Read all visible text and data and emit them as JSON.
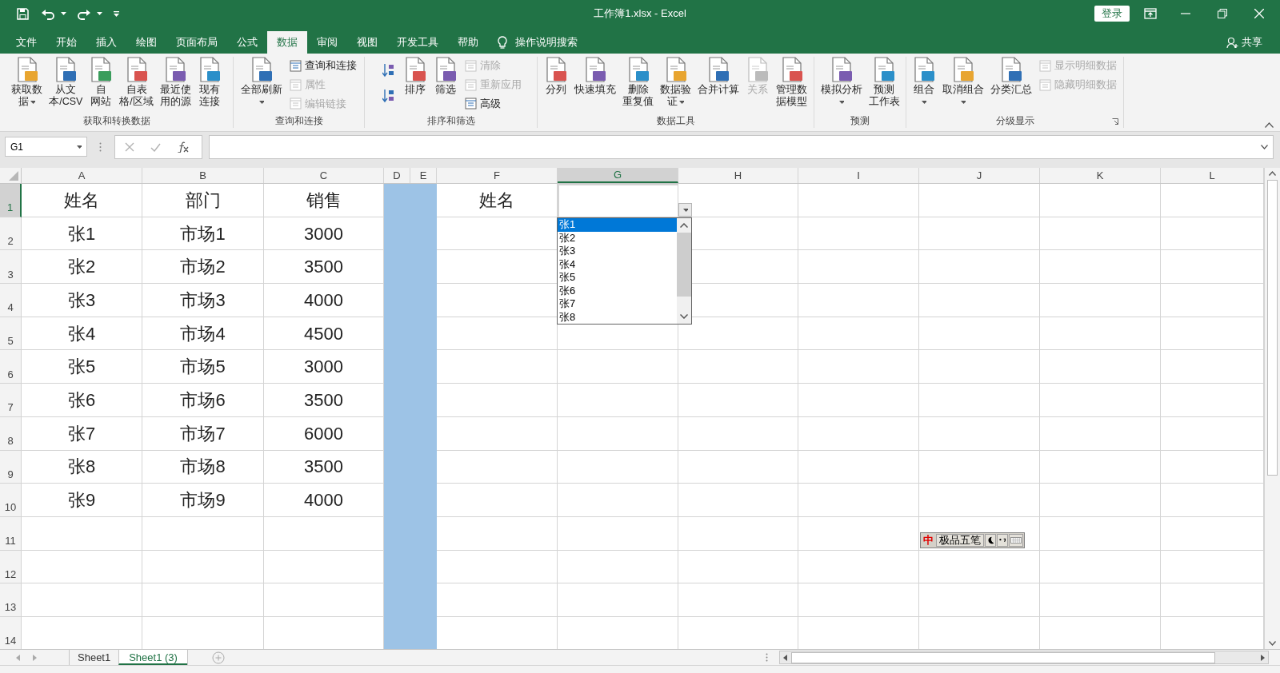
{
  "title_bar": {
    "title": "工作簿1.xlsx  -  Excel",
    "sign_in": "登录"
  },
  "tabs": [
    {
      "label": "文件",
      "selected": false
    },
    {
      "label": "开始",
      "selected": false
    },
    {
      "label": "插入",
      "selected": false
    },
    {
      "label": "绘图",
      "selected": false
    },
    {
      "label": "页面布局",
      "selected": false
    },
    {
      "label": "公式",
      "selected": false
    },
    {
      "label": "数据",
      "selected": true
    },
    {
      "label": "审阅",
      "selected": false
    },
    {
      "label": "视图",
      "selected": false
    },
    {
      "label": "开发工具",
      "selected": false
    },
    {
      "label": "帮助",
      "selected": false
    }
  ],
  "tell_me": "操作说明搜索",
  "share": "共享",
  "ribbon": {
    "groups": [
      {
        "label": "获取和转换数据",
        "launcher": false,
        "items": [
          {
            "kind": "large",
            "lines": [
              "获取数",
              "据"
            ],
            "dropdown": true,
            "disabled": false
          },
          {
            "kind": "large",
            "lines": [
              "从文",
              "本/CSV"
            ],
            "dropdown": false,
            "disabled": false
          },
          {
            "kind": "large",
            "lines": [
              "自",
              "网站"
            ],
            "dropdown": false,
            "disabled": false
          },
          {
            "kind": "large",
            "lines": [
              "自表",
              "格/区域"
            ],
            "dropdown": false,
            "disabled": false
          },
          {
            "kind": "large",
            "lines": [
              "最近使",
              "用的源"
            ],
            "dropdown": false,
            "disabled": false
          },
          {
            "kind": "large",
            "lines": [
              "现有",
              "连接"
            ],
            "dropdown": false,
            "disabled": false
          }
        ]
      },
      {
        "label": "查询和连接",
        "launcher": false,
        "items": [
          {
            "kind": "large",
            "lines": [
              "全部刷新"
            ],
            "dropdown": true,
            "disabled": false
          },
          {
            "kind": "stack",
            "items": [
              {
                "label": "查询和连接",
                "disabled": false
              },
              {
                "label": "属性",
                "disabled": true
              },
              {
                "label": "编辑链接",
                "disabled": true
              }
            ]
          }
        ]
      },
      {
        "label": "排序和筛选",
        "launcher": false,
        "items": [
          {
            "kind": "sort_pair"
          },
          {
            "kind": "large",
            "lines": [
              "排序"
            ],
            "dropdown": false,
            "disabled": false
          },
          {
            "kind": "large",
            "lines": [
              "筛选"
            ],
            "dropdown": false,
            "disabled": false
          },
          {
            "kind": "stack",
            "items": [
              {
                "label": "清除",
                "disabled": true
              },
              {
                "label": "重新应用",
                "disabled": true
              },
              {
                "label": "高级",
                "disabled": false
              }
            ]
          }
        ]
      },
      {
        "label": "数据工具",
        "launcher": false,
        "items": [
          {
            "kind": "large",
            "lines": [
              "分列"
            ],
            "dropdown": false,
            "disabled": false
          },
          {
            "kind": "large",
            "lines": [
              "快速填充"
            ],
            "dropdown": false,
            "disabled": false
          },
          {
            "kind": "large",
            "lines": [
              "删除",
              "重复值"
            ],
            "dropdown": false,
            "disabled": false
          },
          {
            "kind": "large",
            "lines": [
              "数据验",
              "证"
            ],
            "dropdown": true,
            "disabled": false
          },
          {
            "kind": "large",
            "lines": [
              "合并计算"
            ],
            "dropdown": false,
            "disabled": false
          },
          {
            "kind": "large",
            "lines": [
              "关系"
            ],
            "dropdown": false,
            "disabled": true
          },
          {
            "kind": "large",
            "lines": [
              "管理数",
              "据模型"
            ],
            "dropdown": false,
            "disabled": false
          }
        ]
      },
      {
        "label": "预测",
        "launcher": false,
        "items": [
          {
            "kind": "large",
            "lines": [
              "模拟分析"
            ],
            "dropdown": true,
            "disabled": false
          },
          {
            "kind": "large",
            "lines": [
              "预测",
              "工作表"
            ],
            "dropdown": false,
            "disabled": false
          }
        ]
      },
      {
        "label": "分级显示",
        "launcher": true,
        "items": [
          {
            "kind": "large",
            "lines": [
              "组合"
            ],
            "dropdown": true,
            "disabled": false
          },
          {
            "kind": "large",
            "lines": [
              "取消组合"
            ],
            "dropdown": true,
            "disabled": false
          },
          {
            "kind": "large",
            "lines": [
              "分类汇总"
            ],
            "dropdown": false,
            "disabled": false
          },
          {
            "kind": "stack",
            "items": [
              {
                "label": "显示明细数据",
                "disabled": true
              },
              {
                "label": "隐藏明细数据",
                "disabled": true
              }
            ]
          }
        ]
      }
    ]
  },
  "formula_bar": {
    "name_box": "G1"
  },
  "columns": [
    {
      "label": "A",
      "selected": false,
      "highlighted": false
    },
    {
      "label": "B",
      "selected": false,
      "highlighted": false
    },
    {
      "label": "C",
      "selected": false,
      "highlighted": false
    },
    {
      "label": "D",
      "selected": false,
      "highlighted": true
    },
    {
      "label": "E",
      "selected": false,
      "highlighted": true
    },
    {
      "label": "F",
      "selected": false,
      "highlighted": false
    },
    {
      "label": "G",
      "selected": true,
      "highlighted": false
    },
    {
      "label": "H",
      "selected": false,
      "highlighted": false
    },
    {
      "label": "I",
      "selected": false,
      "highlighted": false
    },
    {
      "label": "J",
      "selected": false,
      "highlighted": false
    },
    {
      "label": "K",
      "selected": false,
      "highlighted": false
    },
    {
      "label": "L",
      "selected": false,
      "highlighted": false
    }
  ],
  "rows": [
    {
      "header": "1",
      "selected": true,
      "cells": {
        "a": "姓名",
        "b": "部门",
        "c": "销售",
        "f": "姓名"
      }
    },
    {
      "header": "2",
      "selected": false,
      "cells": {
        "a": "张1",
        "b": "市场1",
        "c": "3000"
      }
    },
    {
      "header": "3",
      "selected": false,
      "cells": {
        "a": "张2",
        "b": "市场2",
        "c": "3500"
      }
    },
    {
      "header": "4",
      "selected": false,
      "cells": {
        "a": "张3",
        "b": "市场3",
        "c": "4000"
      }
    },
    {
      "header": "5",
      "selected": false,
      "cells": {
        "a": "张4",
        "b": "市场4",
        "c": "4500"
      }
    },
    {
      "header": "6",
      "selected": false,
      "cells": {
        "a": "张5",
        "b": "市场5",
        "c": "3000"
      }
    },
    {
      "header": "7",
      "selected": false,
      "cells": {
        "a": "张6",
        "b": "市场6",
        "c": "3500"
      }
    },
    {
      "header": "8",
      "selected": false,
      "cells": {
        "a": "张7",
        "b": "市场7",
        "c": "6000"
      }
    },
    {
      "header": "9",
      "selected": false,
      "cells": {
        "a": "张8",
        "b": "市场8",
        "c": "3500"
      }
    },
    {
      "header": "10",
      "selected": false,
      "cells": {
        "a": "张9",
        "b": "市场9",
        "c": "4000"
      }
    },
    {
      "header": "11",
      "selected": false
    },
    {
      "header": "12",
      "selected": false
    },
    {
      "header": "13",
      "selected": false
    },
    {
      "header": "14",
      "selected": false
    }
  ],
  "validation_list": {
    "items": [
      {
        "label": "张1",
        "selected": true
      },
      {
        "label": "张2",
        "selected": false
      },
      {
        "label": "张3",
        "selected": false
      },
      {
        "label": "张4",
        "selected": false
      },
      {
        "label": "张5",
        "selected": false
      },
      {
        "label": "张6",
        "selected": false
      },
      {
        "label": "张7",
        "selected": false
      },
      {
        "label": "张8",
        "selected": false
      }
    ]
  },
  "ime_toolbar": {
    "mode": "中",
    "label": "极品五笔"
  },
  "sheet_tabs": [
    {
      "label": "Sheet1",
      "selected": false
    },
    {
      "label": "Sheet1 (3)",
      "selected": true
    }
  ]
}
